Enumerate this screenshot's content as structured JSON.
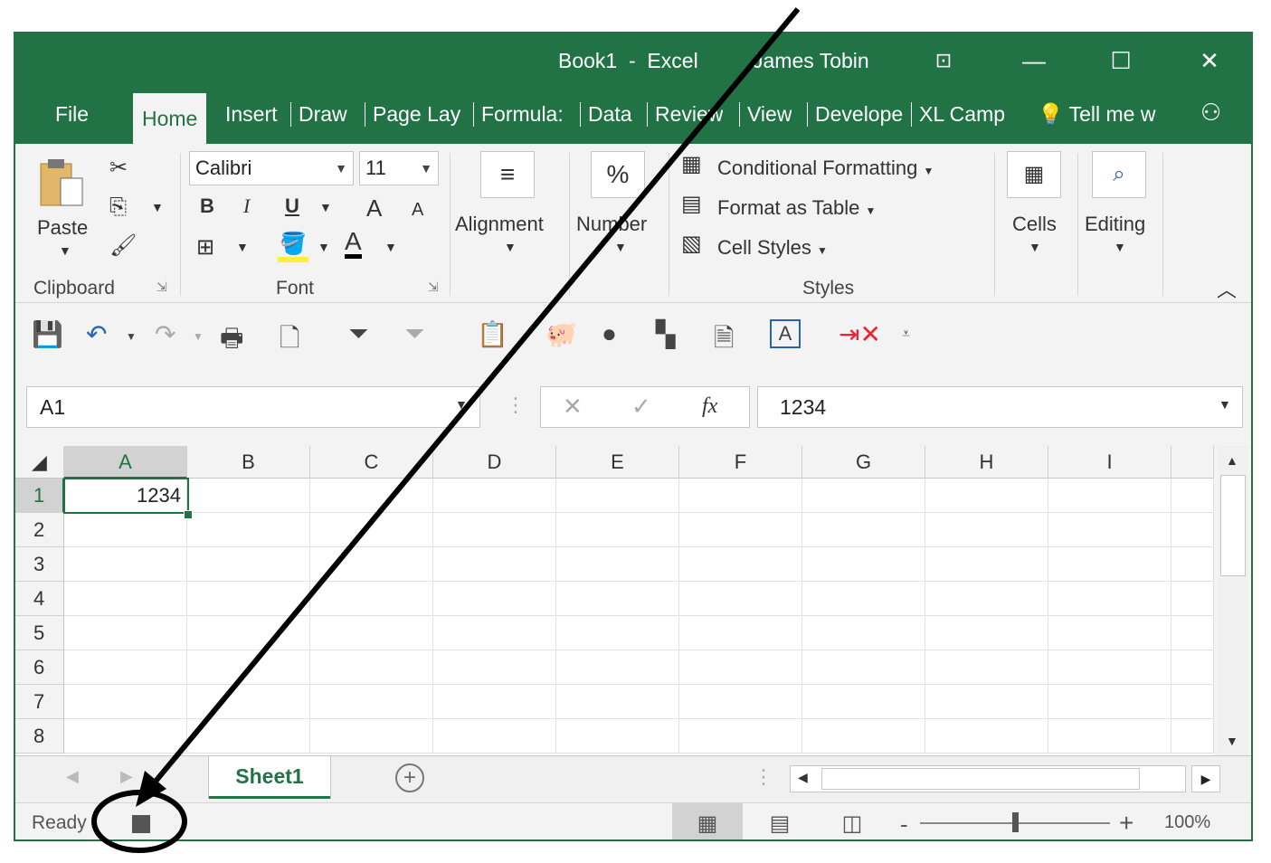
{
  "window": {
    "title": "Book1  -  Excel",
    "user": "James Tobin",
    "controls": [
      "⊡",
      "—",
      "☐",
      "✕"
    ]
  },
  "tabs": {
    "file": "File",
    "home": "Home",
    "insert": "Insert",
    "draw": "Draw",
    "page_layout": "Page Lay",
    "formulas": "Formula:",
    "data": "Data",
    "review": "Review",
    "view": "View",
    "developer": "Develope",
    "xl_camp": "XL Camp",
    "tell_me": "Tell me w"
  },
  "ribbon": {
    "clipboard": {
      "paste": "Paste",
      "group_label": "Clipboard"
    },
    "font": {
      "name": "Calibri",
      "size": "11",
      "bold": "B",
      "italic": "I",
      "underline": "U",
      "grow": "A",
      "shrink": "A",
      "color": "A",
      "group_label": "Font"
    },
    "alignment": {
      "label": "Alignment"
    },
    "number": {
      "label": "Number",
      "symbol": "%"
    },
    "styles": {
      "conditional": "Conditional Formatting",
      "format_table": "Format as Table",
      "cell_styles": "Cell Styles",
      "group_label": "Styles"
    },
    "cells": {
      "label": "Cells"
    },
    "editing": {
      "label": "Editing"
    }
  },
  "formula_bar": {
    "name_box": "A1",
    "cancel": "✕",
    "enter": "✓",
    "fx": "fx",
    "value": "1234"
  },
  "grid": {
    "columns": [
      "A",
      "B",
      "C",
      "D",
      "E",
      "F",
      "G",
      "H",
      "I"
    ],
    "rows": [
      "1",
      "2",
      "3",
      "4",
      "5",
      "6",
      "7",
      "8"
    ],
    "cell_a1": "1234"
  },
  "sheets": {
    "active": "Sheet1",
    "add": "+"
  },
  "status": {
    "ready": "Ready",
    "zoom_minus": "-",
    "zoom_plus": "+",
    "zoom": "100%",
    "zoom_level_percent": 100
  },
  "annotation": {
    "color": "#000000"
  }
}
